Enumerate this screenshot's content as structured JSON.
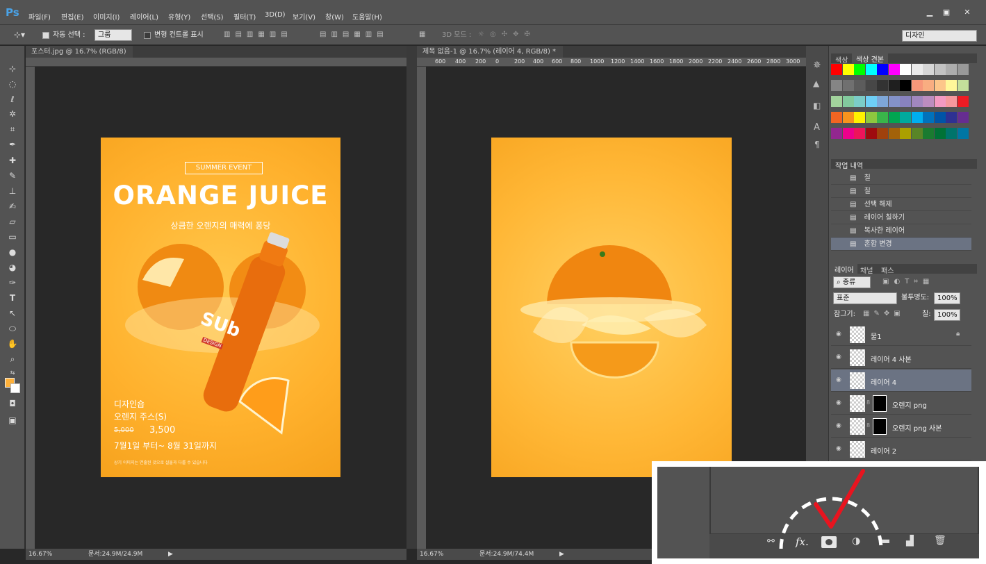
{
  "app": {
    "logo": "Ps"
  },
  "menu": [
    "파일(F)",
    "편집(E)",
    "이미지(I)",
    "레이어(L)",
    "유형(Y)",
    "선택(S)",
    "필터(T)",
    "3D(D)",
    "보기(V)",
    "창(W)",
    "도움말(H)"
  ],
  "window_controls": {
    "minimize": "▁",
    "maximize": "▣",
    "close": "✕"
  },
  "options": {
    "auto_select_label": "자동 선택 :",
    "auto_select_value": "그룹",
    "transform_label": "변형 컨트롤 표시",
    "mode_3d": "3D 모드 :",
    "workspace": "디자인"
  },
  "documents": [
    {
      "tab": "포스터.jpg @ 16.7% (RGB/8)",
      "zoom": "16.67%",
      "doc": "문서:24.9M/24.9M"
    },
    {
      "tab": "제목 없음-1 @ 16.7% (레이어 4, RGB/8) *",
      "zoom": "16.67%",
      "doc": "문서:24.9M/74.4M"
    }
  ],
  "ruler_top_2": [
    "600",
    "400",
    "200",
    "0",
    "200",
    "400",
    "600",
    "800",
    "1000",
    "1200",
    "1400",
    "1600",
    "1800",
    "2000",
    "2200",
    "2400",
    "2600",
    "2800",
    "3000"
  ],
  "poster": {
    "event": "SUMMER EVENT",
    "title": "ORANGE JUICE",
    "subtitle": "상큼한 오렌지의 매력에 퐁당",
    "bottle_brand": "SUb",
    "bottle_sub": "DESIGN",
    "product_line1": "디자인숍",
    "product_line2": "오렌지 주스(S)",
    "old_price": "5,000",
    "new_price": "3,500",
    "period": "7월1일 부터~ 8월 31일까지",
    "note": "상기 이미지는 연출된 것으로 실물과 다를 수 있습니다"
  },
  "swatch_panel": {
    "tabs": [
      "색상",
      "색상 견본"
    ]
  },
  "history": {
    "tab": "작업 내역",
    "items": [
      "칠",
      "칠",
      "선택 해제",
      "레이어 칠하기",
      "복사한 레이어",
      "혼합 변경"
    ]
  },
  "layers": {
    "tabs": [
      "레이어",
      "채널",
      "패스"
    ],
    "filter_kind": "종류",
    "blend_mode": "표준",
    "opacity_label": "불투명도:",
    "opacity": "100%",
    "lock_label": "잠그기:",
    "fill_label": "칠:",
    "fill": "100%",
    "items": [
      {
        "name": "물1"
      },
      {
        "name": "레이어 4 사본"
      },
      {
        "name": "레이어 4"
      },
      {
        "name": "오렌지 png"
      },
      {
        "name": "오렌지 png 사본"
      },
      {
        "name": "레이어 2"
      }
    ]
  },
  "inset": {
    "fx_label": "fx."
  },
  "swatch_colors": [
    "#ff0000",
    "#ffff00",
    "#00ff00",
    "#00ffff",
    "#0000ff",
    "#ff00ff",
    "#ffffff",
    "#ebebeb",
    "#d6d6d6",
    "#c2c2c2",
    "#adadad",
    "#999999",
    "#858585",
    "#707070",
    "#5c5c5c",
    "#474747",
    "#333333",
    "#1f1f1f",
    "#000000",
    "#f7977a",
    "#f9ad81",
    "#fdc68a",
    "#fff79a",
    "#c4df9b",
    "#a2d39c",
    "#82ca9d",
    "#7bcdc8",
    "#6ecff6",
    "#7ea7d8",
    "#8493ca",
    "#8882be",
    "#a187be",
    "#bc8dbf",
    "#f49ac2",
    "#f6989d",
    "#ed1c24",
    "#f26522",
    "#f7941d",
    "#fff200",
    "#8dc73f",
    "#39b54a",
    "#00a651",
    "#00a99d",
    "#00aeef",
    "#0072bc",
    "#0054a6",
    "#2e3192",
    "#662d91",
    "#92278f",
    "#ec008c",
    "#ed145b",
    "#9e0b0f",
    "#a0410d",
    "#a36209",
    "#aba000",
    "#598527",
    "#1a7b30",
    "#007236",
    "#00746b",
    "#0076a3"
  ]
}
